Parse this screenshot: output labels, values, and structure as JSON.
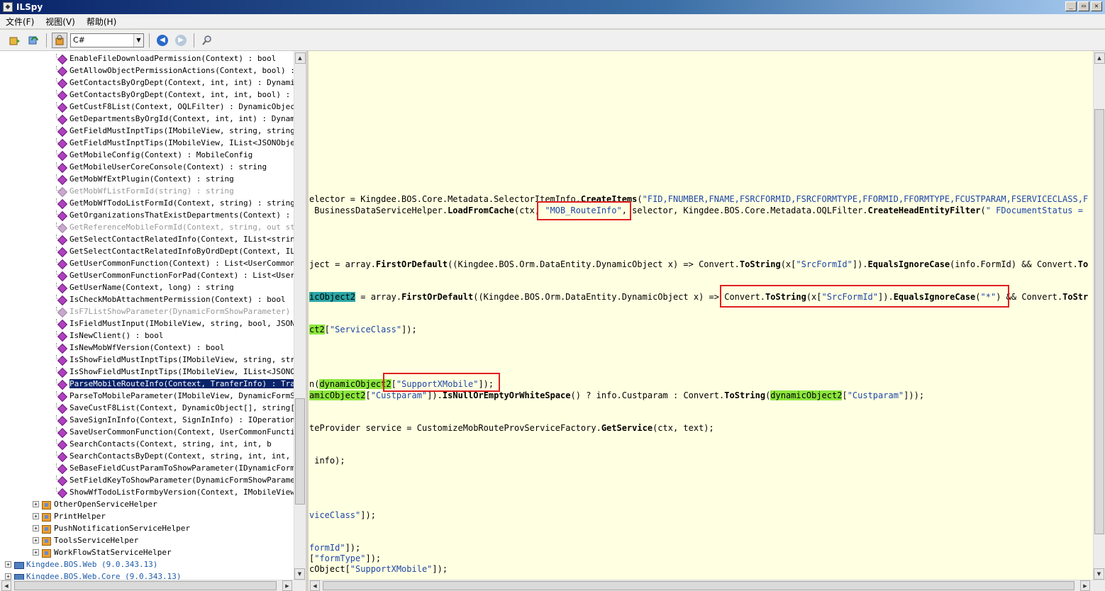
{
  "window": {
    "title": "ILSpy",
    "app_icon": "ilspy-icon"
  },
  "window_buttons": [
    "_",
    "▭",
    "✕"
  ],
  "menu": [
    "文件(F)",
    "视图(V)",
    "帮助(H)"
  ],
  "toolbar": {
    "language": "C#"
  },
  "tree": {
    "methods": [
      {
        "label": "EnableFileDownloadPermission(Context) : bool",
        "grey": false
      },
      {
        "label": "GetAllowObjectPermissionActions(Context, bool) :",
        "grey": false
      },
      {
        "label": "GetContactsByOrgDept(Context, int, int) : Dynami",
        "grey": false
      },
      {
        "label": "GetContactsByOrgDept(Context, int, int, bool) : I",
        "grey": false
      },
      {
        "label": "GetCustF8List(Context, OQLFilter) : DynamicObjec",
        "grey": false
      },
      {
        "label": "GetDepartmentsByOrgId(Context, int, int) : Dynam",
        "grey": false
      },
      {
        "label": "GetFieldMustInptTips(IMobileView, string, string",
        "grey": false
      },
      {
        "label": "GetFieldMustInptTips(IMobileView, IList<JSONObje",
        "grey": false
      },
      {
        "label": "GetMobileConfig(Context) : MobileConfig",
        "grey": false
      },
      {
        "label": "GetMobileUserCoreConsole(Context) : string",
        "grey": false
      },
      {
        "label": "GetMobWfExtPlugin(Context) : string",
        "grey": false
      },
      {
        "label": "GetMobWfListFormId(string) : string",
        "grey": true
      },
      {
        "label": "GetMobWfTodoListFormId(Context, string) : string",
        "grey": false
      },
      {
        "label": "GetOrganizationsThatExistDepartments(Context) : I",
        "grey": false
      },
      {
        "label": "GetReferenceMobileFormId(Context, string, out st",
        "grey": true
      },
      {
        "label": "GetSelectContactRelatedInfo(Context, IList<strin",
        "grey": false
      },
      {
        "label": "GetSelectContactRelatedInfoByOrdDept(Context, IL",
        "grey": false
      },
      {
        "label": "GetUserCommonFunction(Context) : List<UserCommon",
        "grey": false
      },
      {
        "label": "GetUserCommonFunctionForPad(Context) : List<User",
        "grey": false
      },
      {
        "label": "GetUserName(Context, long) : string",
        "grey": false
      },
      {
        "label": "IsCheckMobAttachmentPermission(Context) : bool",
        "grey": false
      },
      {
        "label": "IsF7ListShowParameter(DynamicFormShowParameter)",
        "grey": true
      },
      {
        "label": "IsFieldMustInput(IMobileView, string, bool, JSON",
        "grey": false
      },
      {
        "label": "IsNewClient() : bool",
        "grey": false
      },
      {
        "label": "IsNewMobWfVersion(Context) : bool",
        "grey": false
      },
      {
        "label": "IsShowFieldMustInptTips(IMobileView, string, str",
        "grey": false
      },
      {
        "label": "IsShowFieldMustInptTips(IMobileView, IList<JSONO",
        "grey": false
      },
      {
        "label": "ParseMobileRouteInfo(Context, TranferInfo) : Tra",
        "grey": false,
        "selected": true
      },
      {
        "label": "ParseToMobileParameter(IMobileView, DynamicFormS",
        "grey": false
      },
      {
        "label": "SaveCustF8List(Context, DynamicObject[], string[",
        "grey": false
      },
      {
        "label": "SaveSignInInfo(Context, SignInInfo) : IOperation",
        "grey": false
      },
      {
        "label": "SaveUserCommonFunction(Context, UserCommonFuncti",
        "grey": false
      },
      {
        "label": "SearchContacts(Context, string, int, int, b",
        "grey": false
      },
      {
        "label": "SearchContactsByDept(Context, string, int, int,",
        "grey": false
      },
      {
        "label": "SeBaseFieldCustParamToShowParameter(IDynamicForm",
        "grey": false
      },
      {
        "label": "SetFieldKeyToShowParameter(DynamicFormShowParame",
        "grey": false
      },
      {
        "label": "ShowWfTodoListFormbyVersion(Context, IMobileView",
        "grey": false
      }
    ],
    "classes": [
      "OtherOpenServiceHelper",
      "PrintHelper",
      "PushNotificationServiceHelper",
      "ToolsServiceHelper",
      "WorkFlowStatServiceHelper"
    ],
    "assemblies": [
      "Kingdee.BOS.Web (9.0.343.13)",
      "Kingdee.BOS.Web.Core (9.0.343.13)"
    ]
  },
  "code": {
    "l1": {
      "a": "elector = Kingdee.BOS.Core.Metadata.SelectorItemInfo.",
      "b": "CreateItems",
      "c": "(",
      "d": "\"FID,FNUMBER,FNAME,FSRCFORMID,FSRCFORMTYPE,FFORMID,FFORMTYPE,FCUSTPARAM,FSERVICECLASS,F"
    },
    "l2": {
      "a": " BusinessDataServiceHelper.",
      "b": "LoadFromCache",
      "c": "(ctx, ",
      "d": "\"MOB_RouteInfo\"",
      "e": ", selector, Kingdee.BOS.Core.Metadata.OQLFilter.",
      "f": "CreateHeadEntityFilter",
      "g": "(",
      "h": "\" FDocumentStatus ="
    },
    "l3": {
      "a": "ject = array.",
      "b": "FirstOrDefault",
      "c": "((Kingdee.BOS.Orm.DataEntity.DynamicObject x) => Convert.",
      "d": "ToString",
      "e": "(x[",
      "f": "\"SrcFormId\"",
      "g": "]).",
      "h": "EqualsIgnoreCase",
      "i": "(info.FormId) && Convert.",
      "j": "To"
    },
    "l4": {
      "a": "icObject2",
      "b": " = array.",
      "c": "FirstOrDefault",
      "d": "((Kingdee.BOS.Orm.DataEntity.DynamicObject x) => Convert.",
      "e": "ToString",
      "f": "(x[",
      "g": "\"SrcFormId\"",
      "h": "]).",
      "i": "EqualsIgnoreCase",
      "j": "(",
      "k": "\"*\"",
      "l": ") && Convert.",
      "m": "ToStr"
    },
    "l5": {
      "a": "ct2",
      "b": "[",
      "c": "\"ServiceClass\"",
      "d": "]);"
    },
    "l6": {
      "a": "n(",
      "b": "dynamicObject2",
      "c": "[",
      "d": "\"SupportXMobile\"",
      "e": "]);"
    },
    "l7": {
      "a": "amicObject2",
      "b": "[",
      "c": "\"Custparam\"",
      "d": "]).",
      "e": "IsNullOrEmptyOrWhiteSpace",
      "f": "() ? info.Custparam : Convert.",
      "g": "ToString",
      "h": "(",
      "i": "dynamicObject2",
      "j": "[",
      "k": "\"Custparam\"",
      "l": "]));"
    },
    "l8": {
      "a": "teProvider service = CustomizeMobRouteProvServiceFactory.",
      "b": "GetService",
      "c": "(ctx, text);"
    },
    "l9": {
      "a": " info);"
    },
    "l10": {
      "a": "viceClass\"",
      "b": "]);"
    },
    "l11": {
      "a": "formId\"",
      "b": "]);"
    },
    "l12": {
      "a": "[",
      "b": "\"formType\"",
      "c": "]);"
    },
    "l13": {
      "a": "cObject[",
      "b": "\"SupportXMobile\"",
      "c": "]);"
    }
  }
}
